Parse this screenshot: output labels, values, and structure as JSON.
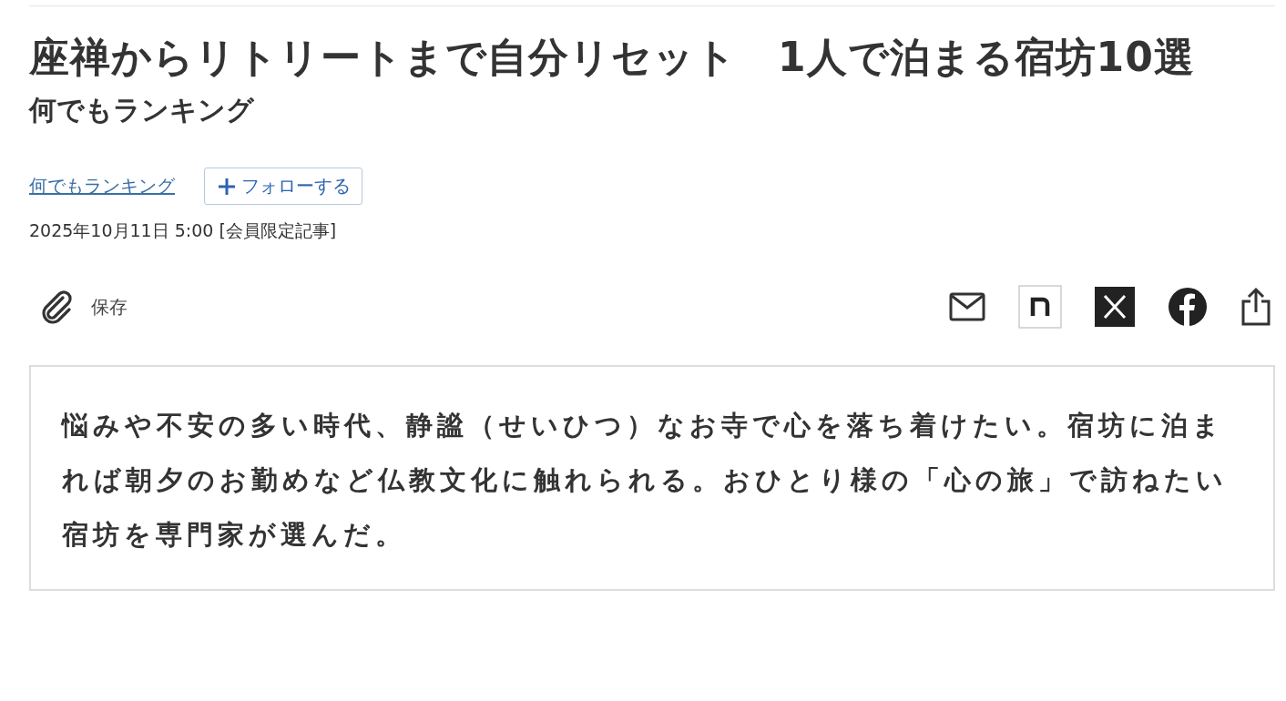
{
  "article": {
    "title": "座禅からリトリートまで自分リセット　1人で泊まる宿坊10選",
    "series": "何でもランキング",
    "series_link": "何でもランキング",
    "follow_button": "フォローする",
    "date": "2025年10月11日 5:00 [会員限定記事]",
    "save_label": "保存",
    "summary": "悩みや不安の多い時代、静謐（せいひつ）なお寺で心を落ち着けたい。宿坊に泊まれば朝夕のお勤めなど仏教文化に触れられる。おひとり様の「心の旅」で訪ねたい宿坊を専門家が選んだ。"
  }
}
